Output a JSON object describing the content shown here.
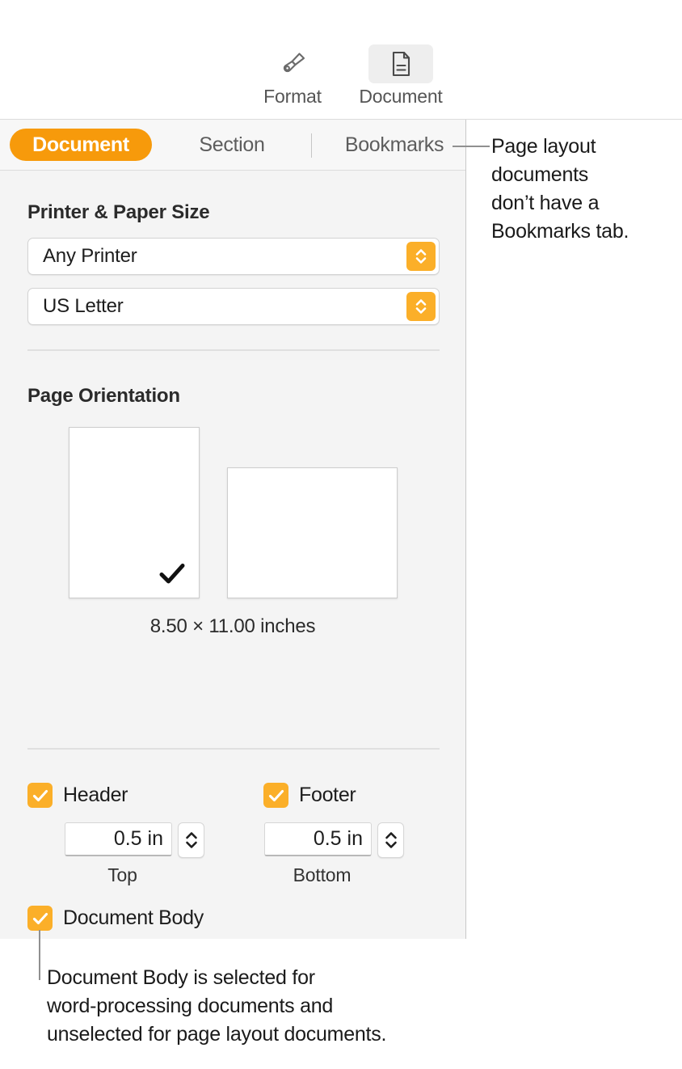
{
  "toolbar": {
    "items": [
      {
        "label": "Format",
        "icon": "paintbrush-icon",
        "active": false
      },
      {
        "label": "Document",
        "icon": "document-page-icon",
        "active": true
      }
    ]
  },
  "tabs": [
    {
      "label": "Document",
      "selected": true
    },
    {
      "label": "Section",
      "selected": false
    },
    {
      "label": "Bookmarks",
      "selected": false
    }
  ],
  "printer_section": {
    "title": "Printer & Paper Size",
    "printer": {
      "value": "Any Printer",
      "icon": "updown-chevrons-icon"
    },
    "paper_size": {
      "value": "US Letter",
      "icon": "updown-chevrons-icon"
    }
  },
  "orientation_section": {
    "title": "Page Orientation",
    "portrait": {
      "name": "portrait",
      "selected": true,
      "check_icon": "checkmark-icon"
    },
    "landscape": {
      "name": "landscape",
      "selected": false
    },
    "dimensions": "8.50 × 11.00 inches"
  },
  "margins_section": {
    "header": {
      "label": "Header",
      "checked": true,
      "value": "0.5 in",
      "caption": "Top"
    },
    "footer": {
      "label": "Footer",
      "checked": true,
      "value": "0.5 in",
      "caption": "Bottom"
    },
    "document_body": {
      "label": "Document Body",
      "checked": true
    }
  },
  "callouts": {
    "bookmarks_note": "Page layout documents don’t have a Bookmarks tab.",
    "bookmarks_note_lines": [
      "Page layout",
      "documents",
      "don’t have a",
      "Bookmarks tab."
    ],
    "document_body_note": "Document Body is selected for word-processing documents and unselected for page layout documents.",
    "document_body_note_lines": [
      "Document Body is selected for",
      "word-processing documents and",
      "unselected for page layout documents."
    ]
  },
  "colors": {
    "accent_orange": "#F79A0B",
    "control_orange": "#FBAF29",
    "panel_bg": "#F4F4F4",
    "tabbar_bg": "#F7F7F7",
    "text_primary": "#1D1D1D",
    "text_secondary": "#5D5D5D",
    "border": "#D3D3D3"
  }
}
